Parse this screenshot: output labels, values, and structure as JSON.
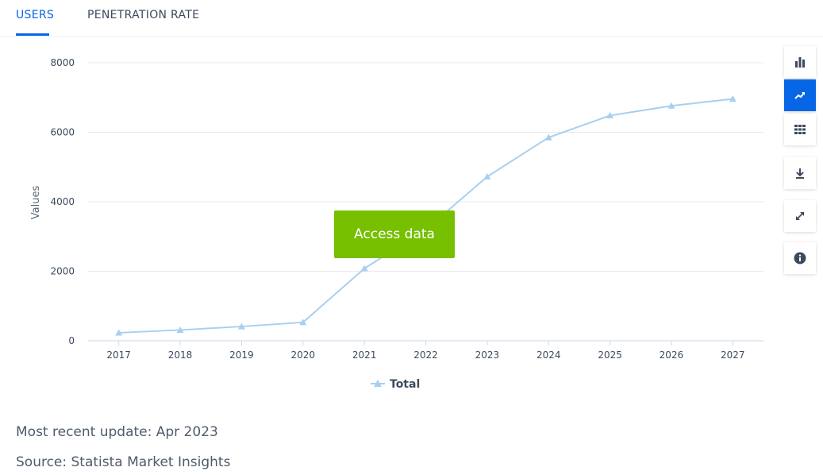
{
  "tabs": [
    {
      "label": "USERS",
      "active": true
    },
    {
      "label": "PENETRATION RATE",
      "active": false
    }
  ],
  "toolbar": {
    "icons": [
      "bar-chart-icon",
      "line-chart-icon",
      "table-icon",
      "download-icon",
      "expand-icon",
      "info-icon"
    ],
    "active": "line-chart-icon"
  },
  "access_button": {
    "label": "Access data"
  },
  "footer": {
    "update": "Most recent update: Apr 2023",
    "source": "Source: Statista Market Insights"
  },
  "colors": {
    "accent": "#0666e6",
    "series": "#a8cff0",
    "access": "#76c000"
  },
  "chart_data": {
    "type": "line",
    "x": [
      "2017",
      "2018",
      "2019",
      "2020",
      "2021",
      "2022",
      "2023",
      "2024",
      "2025",
      "2026",
      "2027"
    ],
    "series": [
      {
        "name": "Total",
        "values": [
          230,
          310,
          410,
          530,
          2080,
          3200,
          4720,
          5850,
          6480,
          6760,
          6960
        ]
      }
    ],
    "ylabel": "Values",
    "ylim": [
      0,
      8000
    ],
    "yticks": [
      0,
      2000,
      4000,
      6000,
      8000
    ],
    "ytick_labels": [
      "0",
      "2000",
      "4000",
      "6000",
      "8000"
    ],
    "marker": "triangle",
    "grid": true,
    "legend": "bottom-center"
  }
}
